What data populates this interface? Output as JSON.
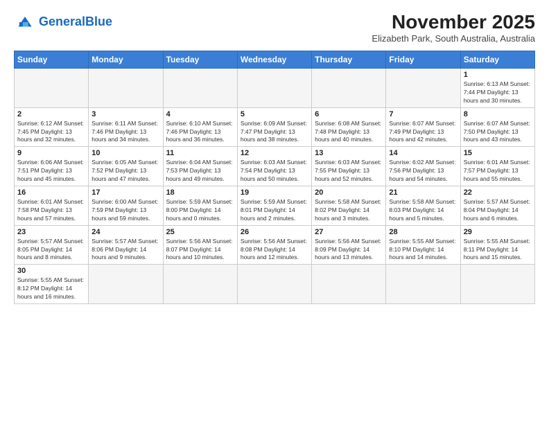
{
  "header": {
    "logo_general": "General",
    "logo_blue": "Blue",
    "month_title": "November 2025",
    "location": "Elizabeth Park, South Australia, Australia"
  },
  "weekdays": [
    "Sunday",
    "Monday",
    "Tuesday",
    "Wednesday",
    "Thursday",
    "Friday",
    "Saturday"
  ],
  "weeks": [
    [
      {
        "day": "",
        "info": ""
      },
      {
        "day": "",
        "info": ""
      },
      {
        "day": "",
        "info": ""
      },
      {
        "day": "",
        "info": ""
      },
      {
        "day": "",
        "info": ""
      },
      {
        "day": "",
        "info": ""
      },
      {
        "day": "1",
        "info": "Sunrise: 6:13 AM\nSunset: 7:44 PM\nDaylight: 13 hours\nand 30 minutes."
      }
    ],
    [
      {
        "day": "2",
        "info": "Sunrise: 6:12 AM\nSunset: 7:45 PM\nDaylight: 13 hours\nand 32 minutes."
      },
      {
        "day": "3",
        "info": "Sunrise: 6:11 AM\nSunset: 7:46 PM\nDaylight: 13 hours\nand 34 minutes."
      },
      {
        "day": "4",
        "info": "Sunrise: 6:10 AM\nSunset: 7:46 PM\nDaylight: 13 hours\nand 36 minutes."
      },
      {
        "day": "5",
        "info": "Sunrise: 6:09 AM\nSunset: 7:47 PM\nDaylight: 13 hours\nand 38 minutes."
      },
      {
        "day": "6",
        "info": "Sunrise: 6:08 AM\nSunset: 7:48 PM\nDaylight: 13 hours\nand 40 minutes."
      },
      {
        "day": "7",
        "info": "Sunrise: 6:07 AM\nSunset: 7:49 PM\nDaylight: 13 hours\nand 42 minutes."
      },
      {
        "day": "8",
        "info": "Sunrise: 6:07 AM\nSunset: 7:50 PM\nDaylight: 13 hours\nand 43 minutes."
      }
    ],
    [
      {
        "day": "9",
        "info": "Sunrise: 6:06 AM\nSunset: 7:51 PM\nDaylight: 13 hours\nand 45 minutes."
      },
      {
        "day": "10",
        "info": "Sunrise: 6:05 AM\nSunset: 7:52 PM\nDaylight: 13 hours\nand 47 minutes."
      },
      {
        "day": "11",
        "info": "Sunrise: 6:04 AM\nSunset: 7:53 PM\nDaylight: 13 hours\nand 49 minutes."
      },
      {
        "day": "12",
        "info": "Sunrise: 6:03 AM\nSunset: 7:54 PM\nDaylight: 13 hours\nand 50 minutes."
      },
      {
        "day": "13",
        "info": "Sunrise: 6:03 AM\nSunset: 7:55 PM\nDaylight: 13 hours\nand 52 minutes."
      },
      {
        "day": "14",
        "info": "Sunrise: 6:02 AM\nSunset: 7:56 PM\nDaylight: 13 hours\nand 54 minutes."
      },
      {
        "day": "15",
        "info": "Sunrise: 6:01 AM\nSunset: 7:57 PM\nDaylight: 13 hours\nand 55 minutes."
      }
    ],
    [
      {
        "day": "16",
        "info": "Sunrise: 6:01 AM\nSunset: 7:58 PM\nDaylight: 13 hours\nand 57 minutes."
      },
      {
        "day": "17",
        "info": "Sunrise: 6:00 AM\nSunset: 7:59 PM\nDaylight: 13 hours\nand 59 minutes."
      },
      {
        "day": "18",
        "info": "Sunrise: 5:59 AM\nSunset: 8:00 PM\nDaylight: 14 hours\nand 0 minutes."
      },
      {
        "day": "19",
        "info": "Sunrise: 5:59 AM\nSunset: 8:01 PM\nDaylight: 14 hours\nand 2 minutes."
      },
      {
        "day": "20",
        "info": "Sunrise: 5:58 AM\nSunset: 8:02 PM\nDaylight: 14 hours\nand 3 minutes."
      },
      {
        "day": "21",
        "info": "Sunrise: 5:58 AM\nSunset: 8:03 PM\nDaylight: 14 hours\nand 5 minutes."
      },
      {
        "day": "22",
        "info": "Sunrise: 5:57 AM\nSunset: 8:04 PM\nDaylight: 14 hours\nand 6 minutes."
      }
    ],
    [
      {
        "day": "23",
        "info": "Sunrise: 5:57 AM\nSunset: 8:05 PM\nDaylight: 14 hours\nand 8 minutes."
      },
      {
        "day": "24",
        "info": "Sunrise: 5:57 AM\nSunset: 8:06 PM\nDaylight: 14 hours\nand 9 minutes."
      },
      {
        "day": "25",
        "info": "Sunrise: 5:56 AM\nSunset: 8:07 PM\nDaylight: 14 hours\nand 10 minutes."
      },
      {
        "day": "26",
        "info": "Sunrise: 5:56 AM\nSunset: 8:08 PM\nDaylight: 14 hours\nand 12 minutes."
      },
      {
        "day": "27",
        "info": "Sunrise: 5:56 AM\nSunset: 8:09 PM\nDaylight: 14 hours\nand 13 minutes."
      },
      {
        "day": "28",
        "info": "Sunrise: 5:55 AM\nSunset: 8:10 PM\nDaylight: 14 hours\nand 14 minutes."
      },
      {
        "day": "29",
        "info": "Sunrise: 5:55 AM\nSunset: 8:11 PM\nDaylight: 14 hours\nand 15 minutes."
      }
    ],
    [
      {
        "day": "30",
        "info": "Sunrise: 5:55 AM\nSunset: 8:12 PM\nDaylight: 14 hours\nand 16 minutes."
      },
      {
        "day": "",
        "info": ""
      },
      {
        "day": "",
        "info": ""
      },
      {
        "day": "",
        "info": ""
      },
      {
        "day": "",
        "info": ""
      },
      {
        "day": "",
        "info": ""
      },
      {
        "day": "",
        "info": ""
      }
    ]
  ]
}
